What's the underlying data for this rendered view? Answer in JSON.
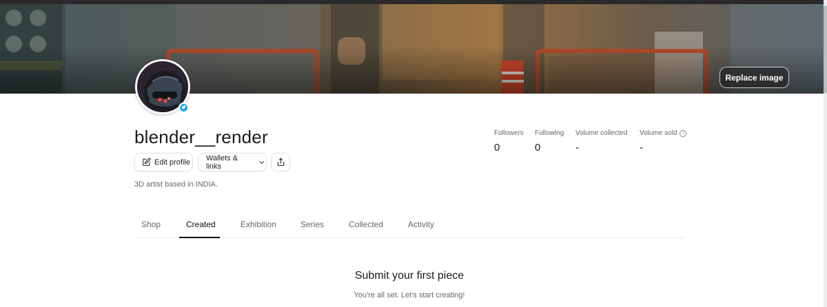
{
  "profile": {
    "username": "blender__render",
    "bio": "3D artist based in INDIA."
  },
  "banner": {
    "replace_label": "Replace image"
  },
  "actions": {
    "edit_profile": "Edit profile",
    "wallets_links": "Wallets & links"
  },
  "stats": [
    {
      "label": "Followers",
      "value": "0"
    },
    {
      "label": "Following",
      "value": "0"
    },
    {
      "label": "Volume collected",
      "value": "-"
    },
    {
      "label": "Volume sold",
      "value": "-"
    }
  ],
  "tabs": [
    {
      "label": "Shop"
    },
    {
      "label": "Created"
    },
    {
      "label": "Exhibition"
    },
    {
      "label": "Series"
    },
    {
      "label": "Collected"
    },
    {
      "label": "Activity"
    }
  ],
  "active_tab": "Created",
  "empty_state": {
    "title": "Submit your first piece",
    "subtitle": "You're all set. Let's start creating!"
  },
  "icons": {
    "edit": "edit-icon",
    "chevron": "chevron-down-icon",
    "share": "share-icon",
    "info": "info-icon",
    "verified": "twitter-verified-icon"
  },
  "colors": {
    "verified_badge": "#1da1f2",
    "text_primary": "#1a1a1a",
    "text_secondary": "#666666"
  }
}
